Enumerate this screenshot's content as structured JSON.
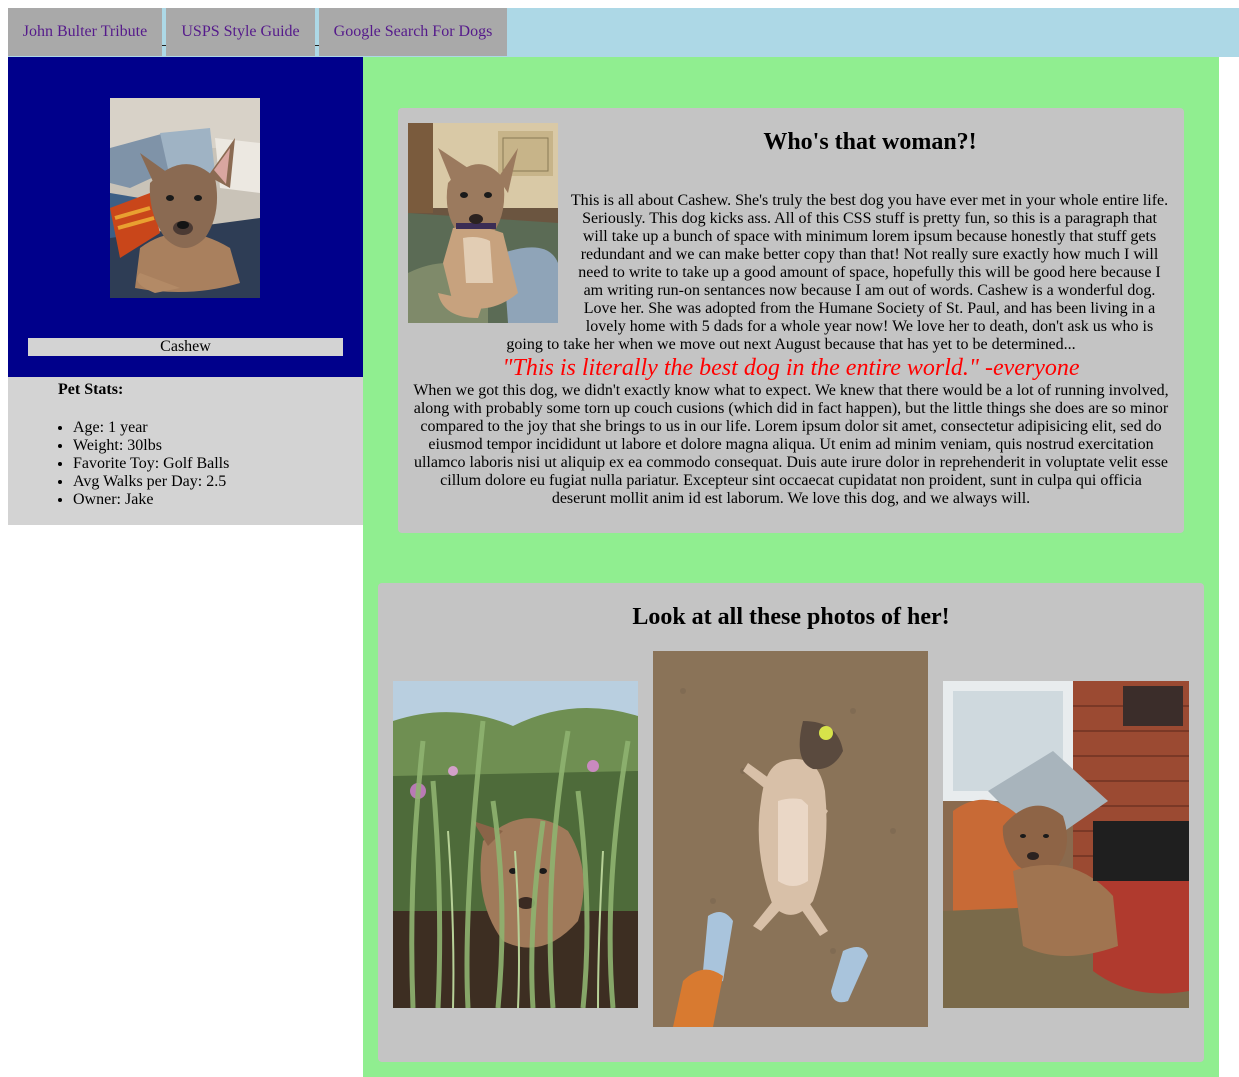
{
  "nav": {
    "items": [
      {
        "label": "John Bulter Tribute"
      },
      {
        "label": "USPS Style Guide"
      },
      {
        "label": "Google Search For Dogs"
      }
    ]
  },
  "profile": {
    "name": "Cashew",
    "photo_alt": "Cashew lying on a blanket"
  },
  "stats": {
    "title": "Pet Stats:",
    "items": [
      "Age: 1 year",
      "Weight: 30lbs",
      "Favorite Toy: Golf Balls",
      "Avg Walks per Day: 2.5",
      "Owner: Jake"
    ]
  },
  "about": {
    "title": "Who's that woman?!",
    "paragraph1": "This is all about Cashew. She's truly the best dog you have ever met in your whole entire life. Seriously. This dog kicks ass. All of this CSS stuff is pretty fun, so this is a paragraph that will take up a bunch of space with minimum lorem ipsum because honestly that stuff gets redundant and we can make better copy than that! Not really sure exactly how much I will need to write to take up a good amount of space, hopefully this will be good here because I am writing run-on sentances now because I am out of words. Cashew is a wonderful dog. Love her. She was adopted from the Humane Society of St. Paul, and has been living in a lovely home with 5 dads for a whole year now! We love her to death, don't ask us who is going to take her when we move out next August because that has yet to be determined...",
    "quote": "\"This is literally the best dog in the entire world.\" -everyone",
    "paragraph2": "When we got this dog, we didn't exactly know what to expect. We knew that there would be a lot of running involved, along with probably some torn up couch cusions (which did in fact happen), but the little things she does are so minor compared to the joy that she brings to us in our life. Lorem ipsum dolor sit amet, consectetur adipisicing elit, sed do eiusmod tempor incididunt ut labore et dolore magna aliqua. Ut enim ad minim veniam, quis nostrud exercitation ullamco laboris nisi ut aliquip ex ea commodo consequat. Duis aute irure dolor in reprehenderit in voluptate velit esse cillum dolore eu fugiat nulla pariatur. Excepteur sint occaecat cupidatat non proident, sunt in culpa qui officia deserunt mollit anim id est laborum. We love this dog, and we always will."
  },
  "gallery": {
    "title": "Look at all these photos of her!"
  },
  "colors": {
    "nav_background": "#add8e6",
    "nav_item": "#a9a9a9",
    "link": "#551a8b",
    "profile_background": "#00008b",
    "stats_background": "#d3d3d3",
    "main_background": "#90ee90",
    "card_background": "#c4c4c4",
    "quote": "#ff0000"
  }
}
